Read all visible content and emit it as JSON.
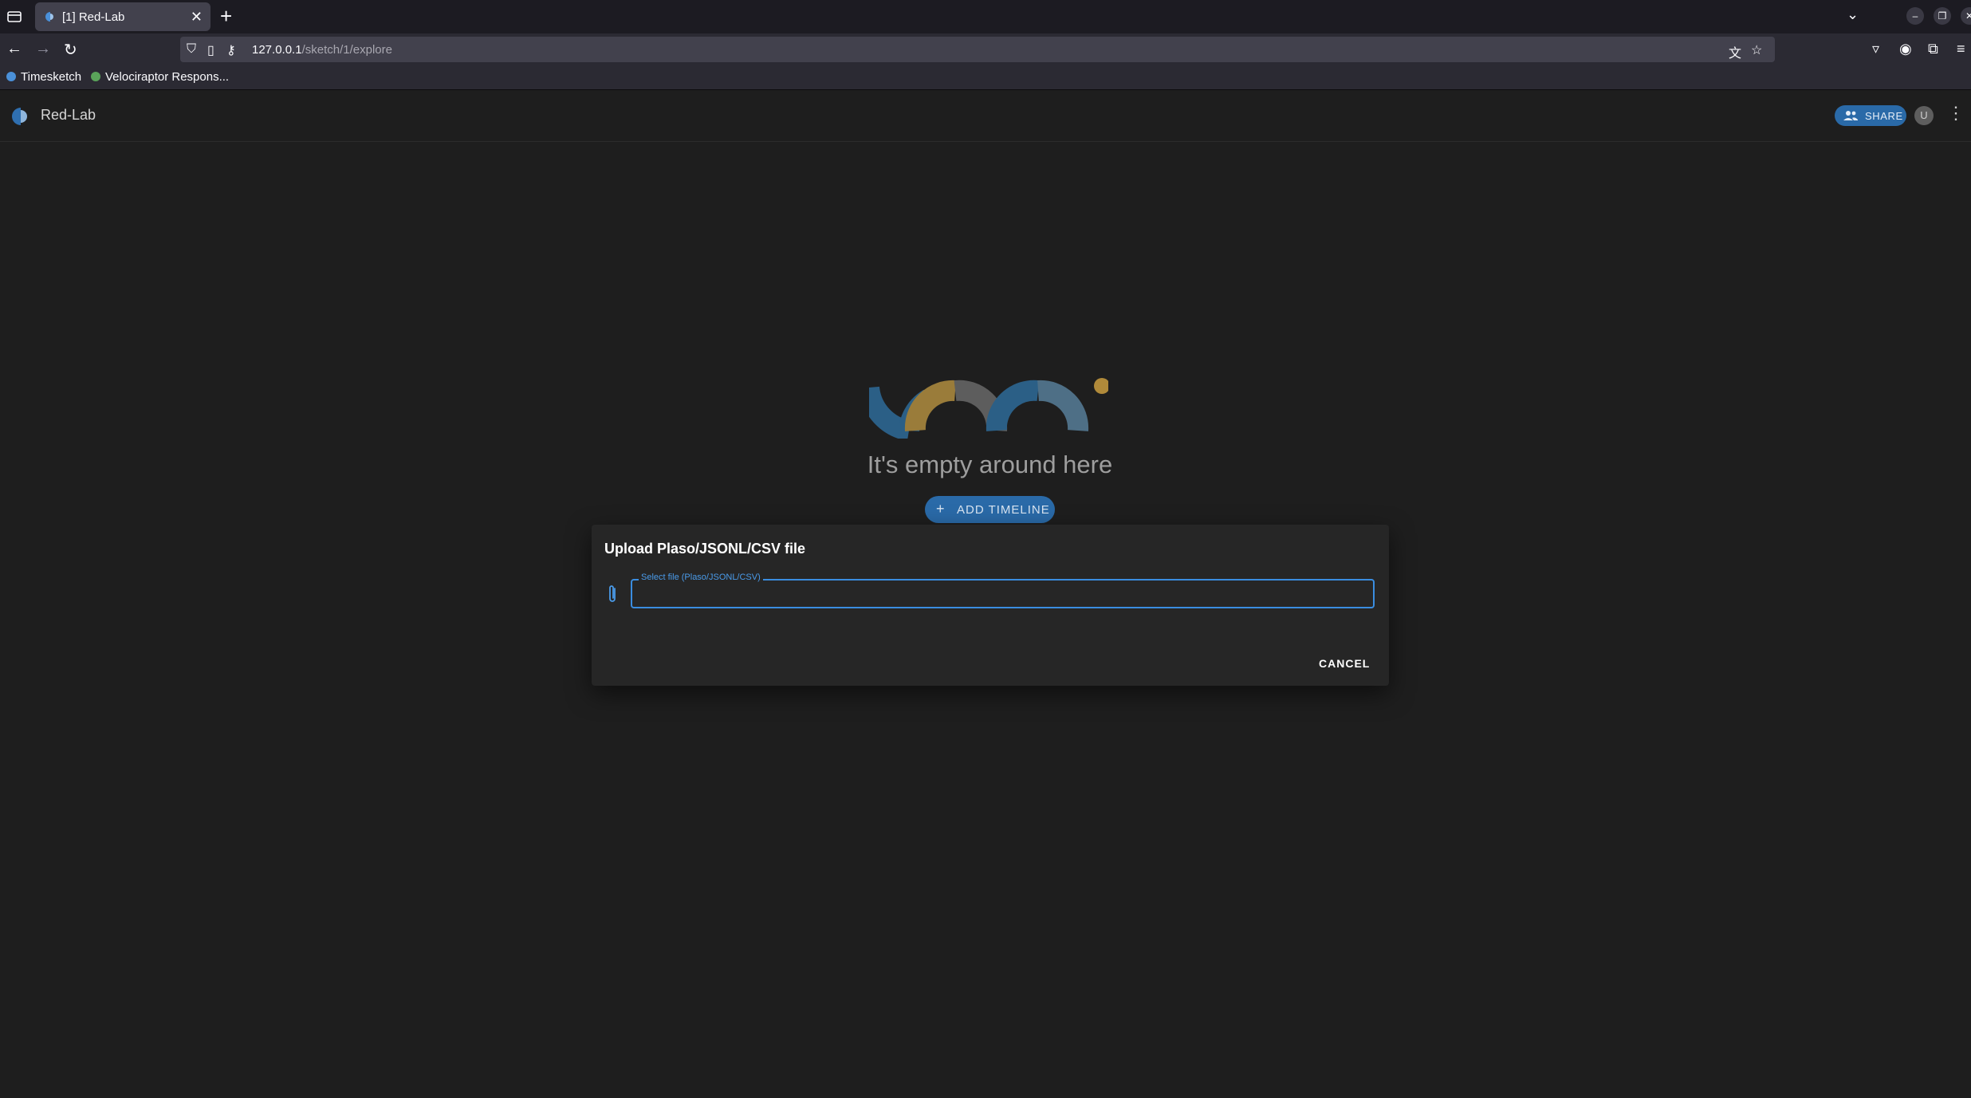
{
  "browser": {
    "tab_title": "[1] Red-Lab",
    "url_host": "127.0.0.1",
    "url_path": "/sketch/1/explore",
    "bookmarks": [
      {
        "label": "Timesketch"
      },
      {
        "label": "Velociraptor Respons..."
      }
    ]
  },
  "app": {
    "title": "Red-Lab",
    "share_label": "SHARE",
    "avatar_initial": "U"
  },
  "empty_state": {
    "message": "It's empty around here",
    "add_timeline_label": "ADD TIMELINE"
  },
  "dialog": {
    "title": "Upload Plaso/JSONL/CSV file",
    "file_field_label": "Select file (Plaso/JSONL/CSV)",
    "cancel_label": "CANCEL"
  },
  "colors": {
    "accent": "#2a6aa8",
    "focus": "#3a8de0",
    "background": "#1e1e1e",
    "dialog": "#262626"
  }
}
